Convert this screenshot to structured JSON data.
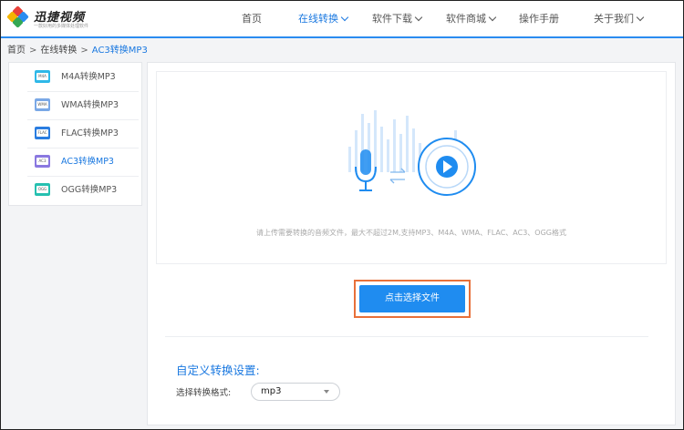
{
  "header": {
    "logo_name": "迅捷视频",
    "logo_sub": "一款好用的多媒体处理软件",
    "nav": [
      {
        "label": "首页",
        "dropdown": false,
        "active": false
      },
      {
        "label": "在线转换",
        "dropdown": true,
        "active": true
      },
      {
        "label": "软件下载",
        "dropdown": true,
        "active": false
      },
      {
        "label": "软件商城",
        "dropdown": true,
        "active": false
      },
      {
        "label": "操作手册",
        "dropdown": false,
        "active": false
      },
      {
        "label": "关于我们",
        "dropdown": true,
        "active": false
      }
    ]
  },
  "breadcrumb": {
    "items": [
      "首页",
      "在线转换",
      "AC3转换MP3"
    ],
    "separator": ">"
  },
  "sidebar": {
    "items": [
      {
        "label": "M4A转换MP3",
        "icon": "m4a-file-icon",
        "icon_text": "M4A",
        "color": "#2fb8e8",
        "active": false
      },
      {
        "label": "WMA转换MP3",
        "icon": "wma-file-icon",
        "icon_text": "WMA",
        "color": "#7aa8e6",
        "active": false
      },
      {
        "label": "FLAC转换MP3",
        "icon": "flac-file-icon",
        "icon_text": "FLAC",
        "color": "#2a7de0",
        "active": false
      },
      {
        "label": "AC3转换MP3",
        "icon": "ac3-file-icon",
        "icon_text": "AC3",
        "color": "#8a78e0",
        "active": true
      },
      {
        "label": "OGG转换MP3",
        "icon": "ogg-file-icon",
        "icon_text": "OGG",
        "color": "#26c0b0",
        "active": false
      }
    ]
  },
  "upload": {
    "hint": "请上传需要转换的音频文件，最大不超过2M,支持MP3、M4A、WMA、FLAC、AC3、OGG格式",
    "illustration": "microphone-to-play-icon",
    "button_label": "点击选择文件"
  },
  "settings": {
    "title": "自定义转换设置:",
    "format_label": "选择转换格式:",
    "format_value": "mp3"
  },
  "colors": {
    "accent": "#1a78e0",
    "header_line": "#2a8cf0",
    "button": "#1f8cf0",
    "highlight_box": "#e8703a"
  }
}
